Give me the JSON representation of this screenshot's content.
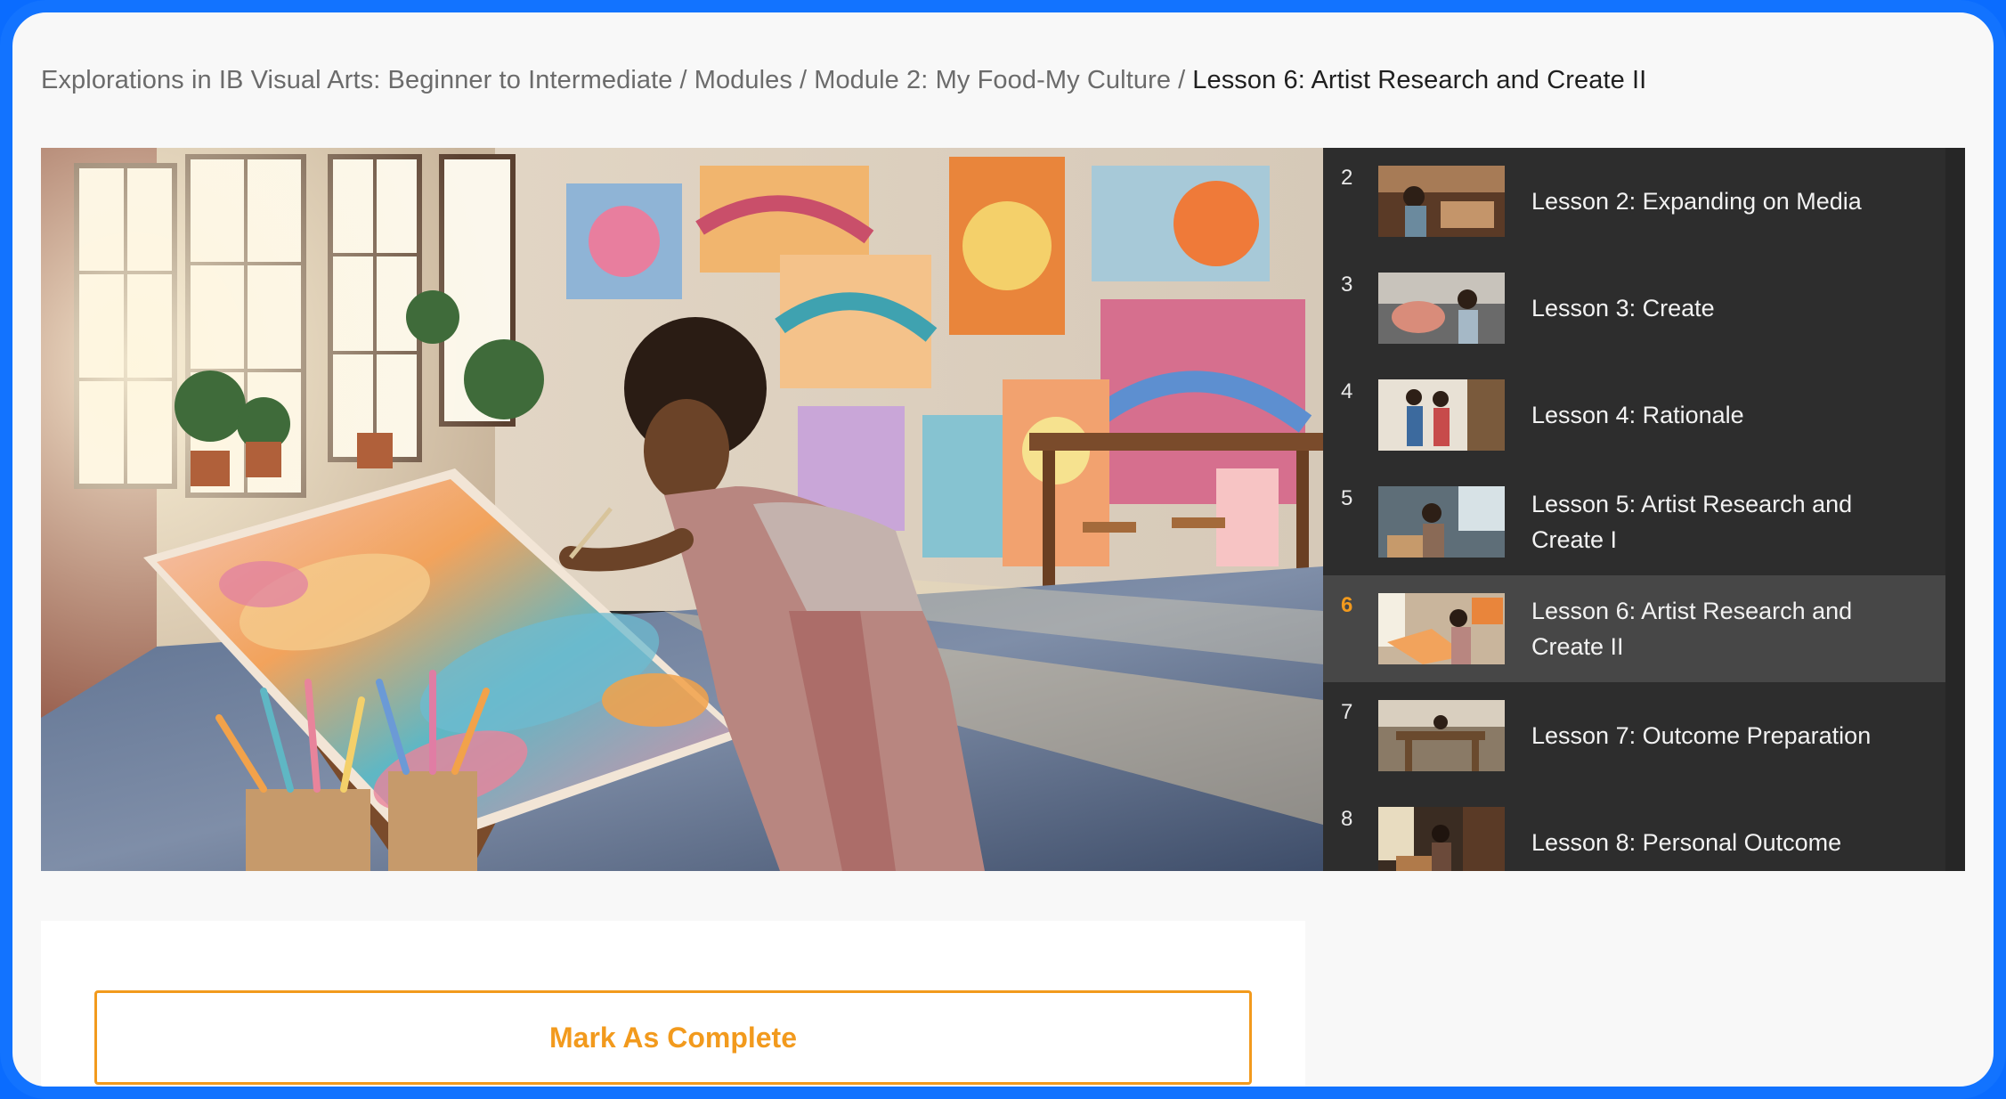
{
  "breadcrumb": {
    "course": "Explorations in IB Visual Arts: Beginner to Intermediate",
    "modules": "Modules",
    "module": "Module 2: My Food-My Culture",
    "current": "Lesson 6: Artist Research and Create II",
    "separator": "/"
  },
  "playlist": {
    "active_color": "#f29a1d",
    "items": [
      {
        "number": "2",
        "title": "Lesson 2: Expanding on Media"
      },
      {
        "number": "3",
        "title": "Lesson 3: Create"
      },
      {
        "number": "4",
        "title": "Lesson 4: Rationale"
      },
      {
        "number": "5",
        "title": "Lesson 5: Artist Research and Create I"
      },
      {
        "number": "6",
        "title": "Lesson 6: Artist Research and Create II",
        "active": true
      },
      {
        "number": "7",
        "title": "Lesson 7: Outcome Preparation"
      },
      {
        "number": "8",
        "title": "Lesson 8: Personal Outcome"
      }
    ]
  },
  "actions": {
    "mark_complete_label": "Mark As Complete"
  },
  "colors": {
    "frame": "#1273ff",
    "accent": "#f29a1d",
    "playlist_bg": "#2d2d2d",
    "active_row": "#474747"
  }
}
